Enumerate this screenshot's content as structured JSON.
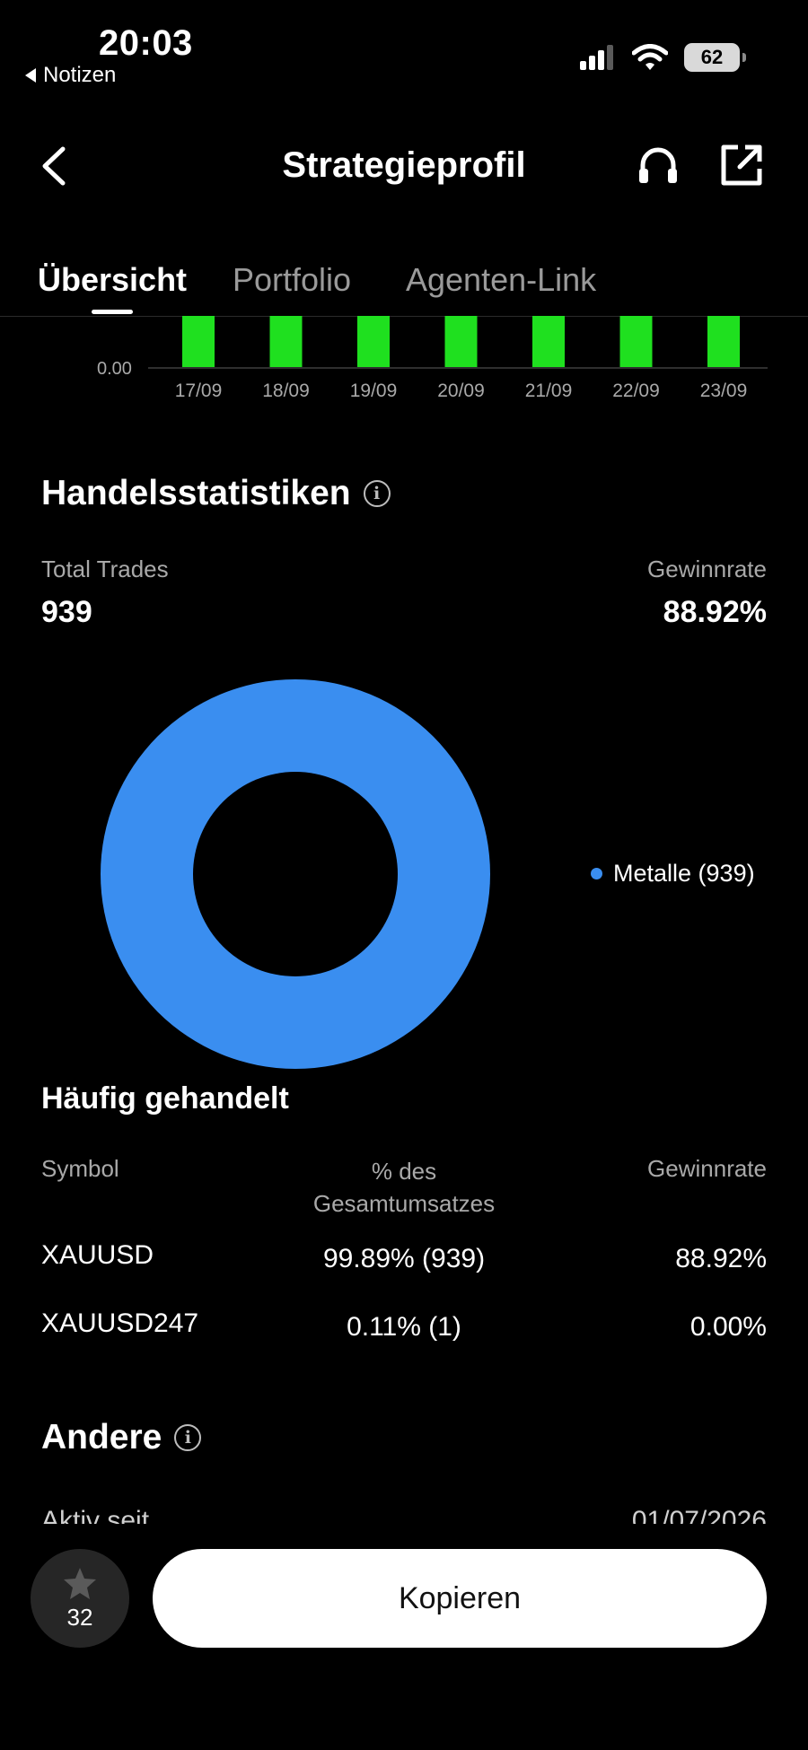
{
  "status_bar": {
    "time": "20:03",
    "back_app": "Notizen",
    "battery": "62"
  },
  "nav": {
    "title": "Strategieprofil"
  },
  "tabs": [
    {
      "label": "Übersicht",
      "active": true
    },
    {
      "label": "Portfolio",
      "active": false
    },
    {
      "label": "Agenten-Link",
      "active": false
    }
  ],
  "bar_chart": {
    "y_label": "0.00",
    "bar_color": "#1fe01f",
    "dates": [
      "17/09",
      "18/09",
      "19/09",
      "20/09",
      "21/09",
      "22/09",
      "23/09"
    ]
  },
  "trade_stats": {
    "title": "Handelsstatistiken",
    "total_trades_label": "Total Trades",
    "total_trades_value": "939",
    "win_rate_label": "Gewinnrate",
    "win_rate_value": "88.92%"
  },
  "chart_data": {
    "type": "pie",
    "donut": true,
    "categories": [
      "Metalle"
    ],
    "values": [
      939
    ],
    "colors": [
      "#3a8ef0"
    ],
    "legend": [
      "Metalle (939)"
    ],
    "legend_position": "right"
  },
  "frequently_traded": {
    "title": "Häufig gehandelt",
    "headers": {
      "symbol": "Symbol",
      "share_line1": "% des",
      "share_line2": "Gesamtumsatzes",
      "win_rate": "Gewinnrate"
    },
    "rows": [
      {
        "symbol": "XAUUSD",
        "share": "99.89% (939)",
        "win_rate": "88.92%"
      },
      {
        "symbol": "XAUUSD247",
        "share": "0.11% (1)",
        "win_rate": "0.00%"
      }
    ]
  },
  "other": {
    "title": "Andere",
    "active_since_label": "Aktiv seit",
    "active_since_value": "01/07/2026"
  },
  "bottom": {
    "star_count": "32",
    "copy_label": "Kopieren"
  },
  "colors": {
    "accent_blue": "#3a8ef0",
    "bar_green": "#1fe01f",
    "background": "#000000"
  }
}
